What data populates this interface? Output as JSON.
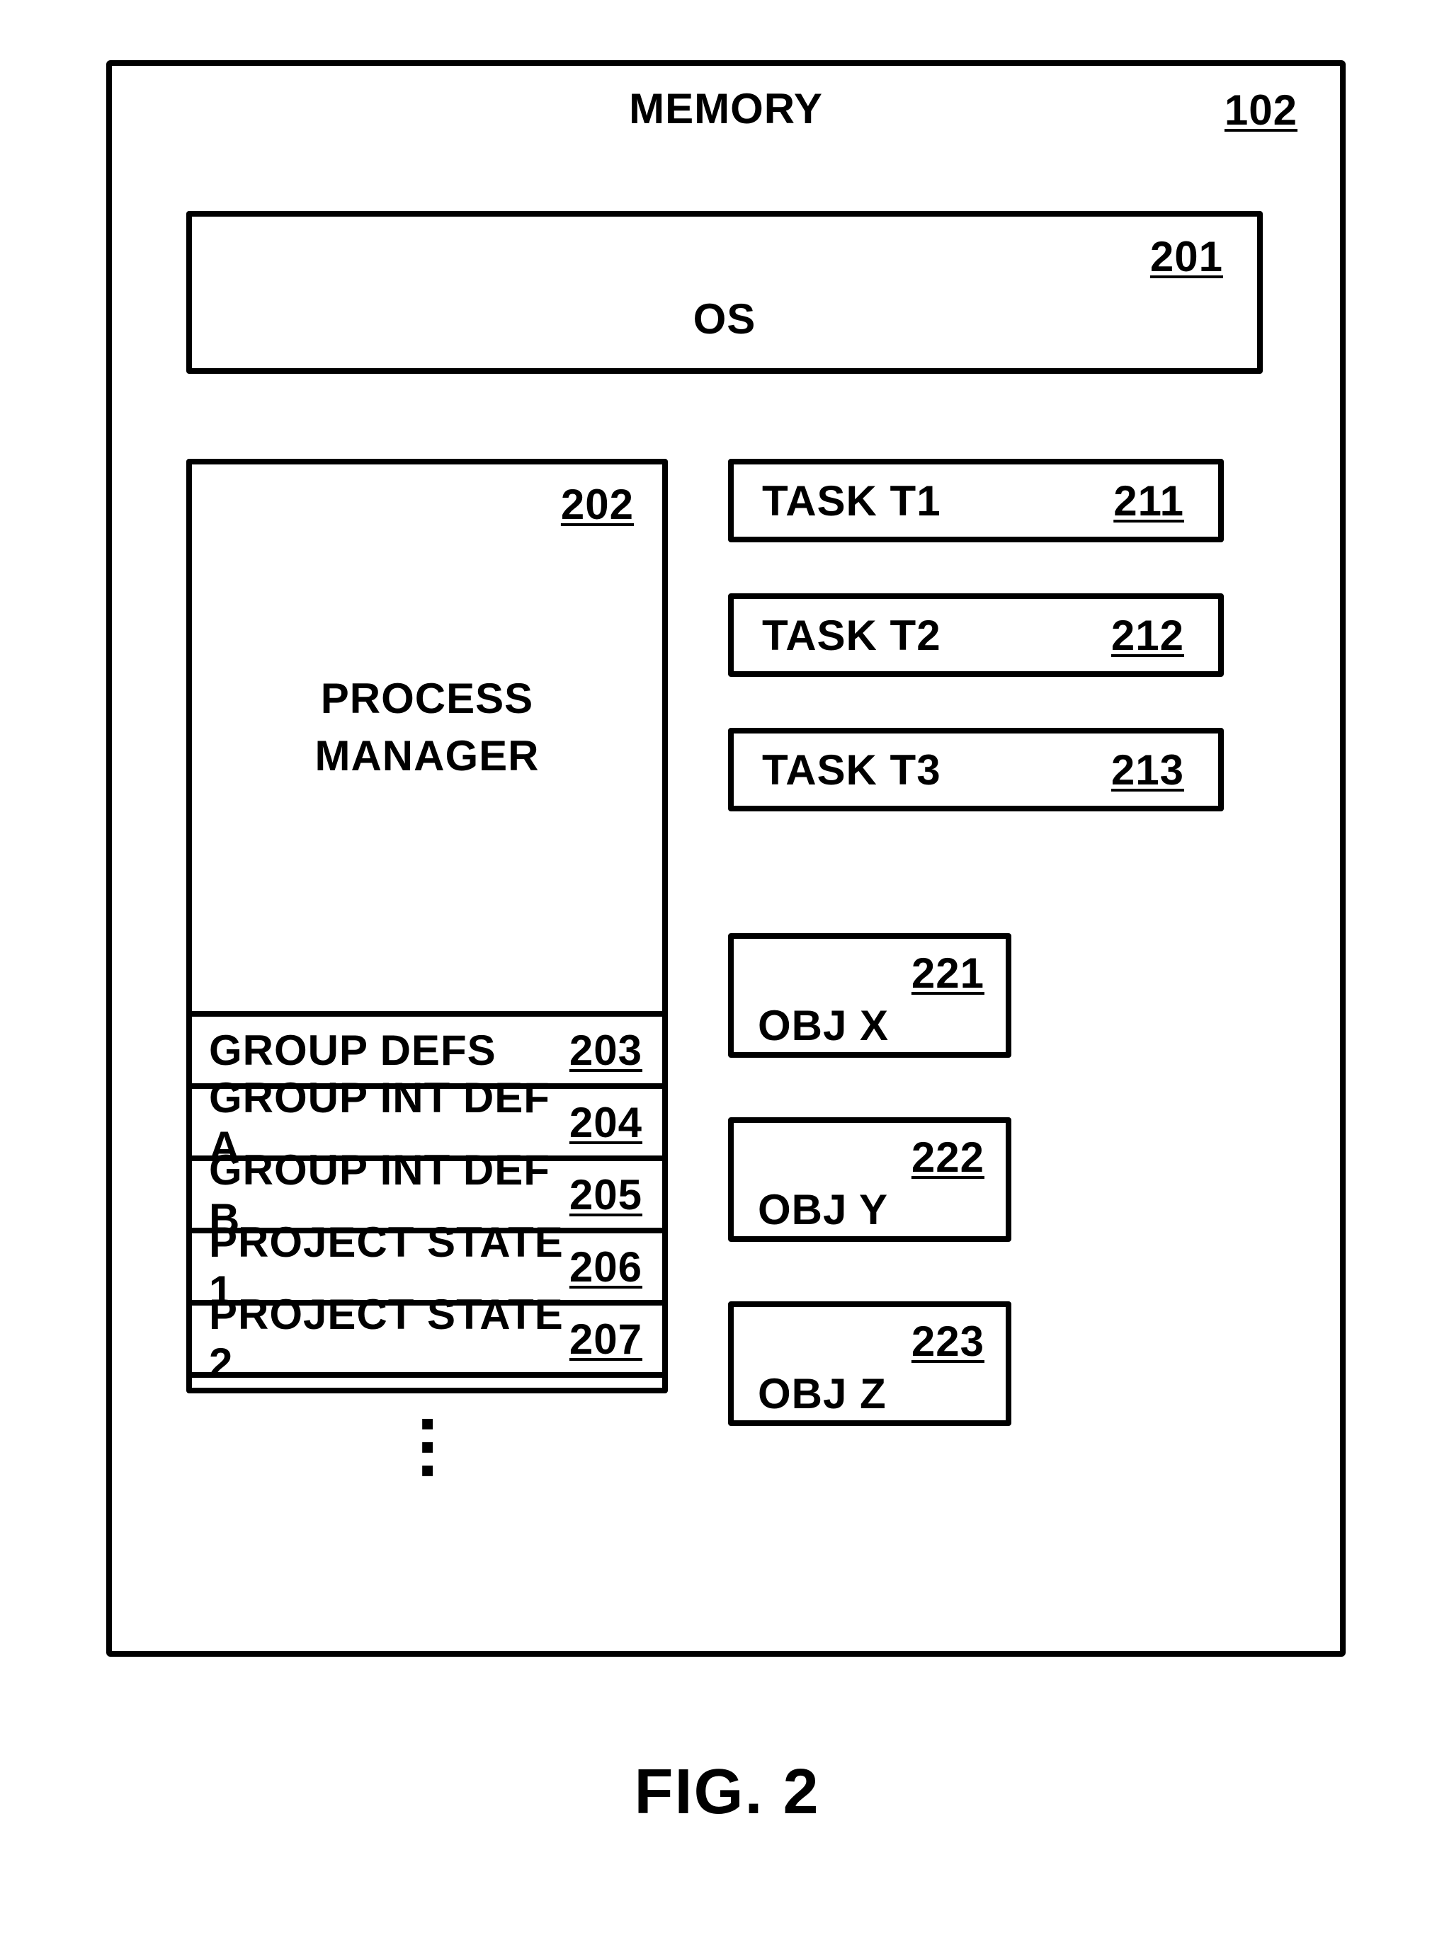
{
  "figure_label": "FIG. 2",
  "memory": {
    "title": "MEMORY",
    "ref": "102",
    "os": {
      "label": "OS",
      "ref": "201"
    },
    "process_manager": {
      "title_line1": "PROCESS",
      "title_line2": "MANAGER",
      "ref": "202",
      "rows": [
        {
          "label": "GROUP DEFS",
          "ref": "203"
        },
        {
          "label": "GROUP INT DEF A",
          "ref": "204"
        },
        {
          "label": "GROUP INT DEF B",
          "ref": "205"
        },
        {
          "label": "PROJECT STATE 1",
          "ref": "206"
        },
        {
          "label": "PROJECT STATE 2",
          "ref": "207"
        }
      ]
    },
    "tasks": [
      {
        "label": "TASK T1",
        "ref": "211"
      },
      {
        "label": "TASK T2",
        "ref": "212"
      },
      {
        "label": "TASK T3",
        "ref": "213"
      }
    ],
    "objects": [
      {
        "label": "OBJ X",
        "ref": "221"
      },
      {
        "label": "OBJ Y",
        "ref": "222"
      },
      {
        "label": "OBJ Z",
        "ref": "223"
      }
    ]
  }
}
